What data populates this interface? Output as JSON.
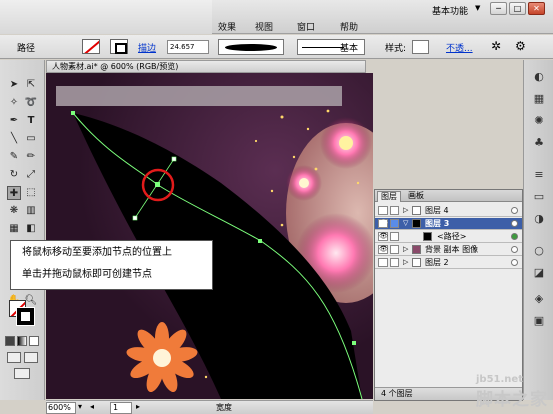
{
  "menu": {
    "items": [
      "效果",
      "视图",
      "窗口",
      "帮助"
    ]
  },
  "workspace": {
    "label": "基本功能"
  },
  "window_buttons": {
    "minimize": "─",
    "restore": "□",
    "close": "✕"
  },
  "control": {
    "object_type": "路径",
    "stroke_link": "描边",
    "stroke_weight": "24.657",
    "style_name": "基本",
    "style_label": "样式:",
    "opacity_link": "不透..."
  },
  "document": {
    "tab_title": "人物素材.ai* @ 600% (RGB/预览)",
    "close": "×"
  },
  "layers_panel": {
    "tabs": [
      "图层",
      "画板"
    ],
    "layers": [
      {
        "name": "图层 4",
        "selected": false,
        "sub": false
      },
      {
        "name": "图层 3",
        "selected": true,
        "sub": false
      },
      {
        "name": "<路径>",
        "selected": false,
        "sub": true
      },
      {
        "name": "背景 副本 图像",
        "selected": false,
        "sub": false
      },
      {
        "name": "图层 2",
        "selected": false,
        "sub": false
      }
    ],
    "footer": "4 个图层"
  },
  "tooltip": {
    "line1": "将鼠标移动至要添加节点的位置上",
    "line2": "单击并拖动鼠标即可创建节点"
  },
  "status": {
    "zoom": "600%",
    "page": "1",
    "mode": "宽度"
  },
  "watermark": {
    "url": "jb51.net",
    "name": "脚本之家"
  },
  "colors": {
    "selected_layer": "#3d5fa8",
    "path_stroke": "#7cff7c",
    "highlight_circle": "#e21b1b",
    "tooltip_bg": "#ffffff"
  }
}
